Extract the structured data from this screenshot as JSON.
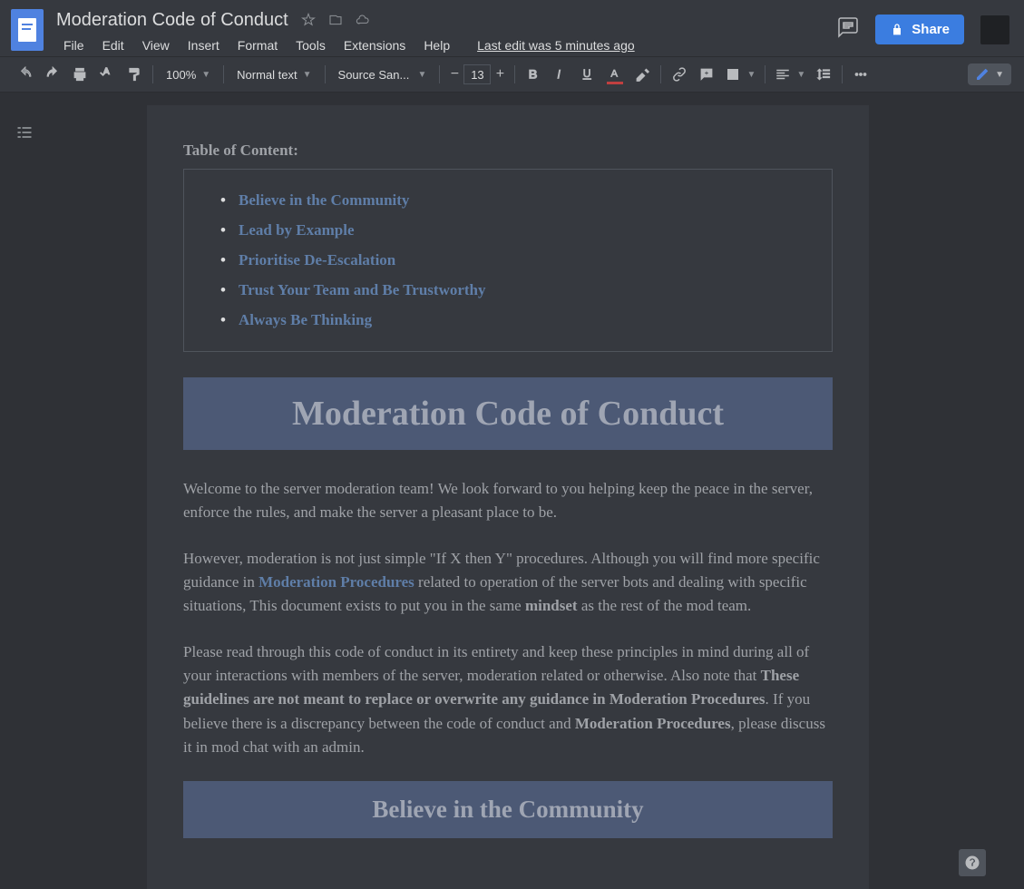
{
  "header": {
    "title": "Moderation Code of Conduct",
    "last_edit": "Last edit was 5 minutes ago",
    "share_label": "Share"
  },
  "menubar": [
    "File",
    "Edit",
    "View",
    "Insert",
    "Format",
    "Tools",
    "Extensions",
    "Help"
  ],
  "toolbar": {
    "zoom": "100%",
    "style": "Normal text",
    "font": "Source San...",
    "font_size": "13"
  },
  "doc": {
    "toc_header": "Table of Content:",
    "toc": [
      "Believe in the Community",
      "Lead by Example",
      "Prioritise De-Escalation",
      "Trust Your Team and Be Trustworthy",
      "Always Be Thinking"
    ],
    "main_title": "Moderation Code of Conduct",
    "p1": "Welcome to the server moderation team! We look forward to you helping keep the peace in the server, enforce the rules, and make the server a pleasant place to be.",
    "p2a": "However, moderation is not just simple \"If X then Y\" procedures. Although you will find more specific guidance in ",
    "p2_link": "Moderation Procedures",
    "p2b": " related to operation of the server bots and dealing with specific situations, This document exists to put you in the same ",
    "p2_bold": "mindset",
    "p2c": " as the rest of the mod team.",
    "p3a": "Please read through this code of conduct in its entirety and keep these principles in mind during all of your interactions with members of the server, moderation related or otherwise. Also note that ",
    "p3_bold1": "These guidelines are not meant to replace or overwrite any guidance in Moderation Procedures",
    "p3b": ". If you believe there is a discrepancy between the code of conduct and ",
    "p3_bold2": "Moderation Procedures",
    "p3c": ", please discuss it in mod chat with an admin.",
    "section1": "Believe in the Community"
  }
}
